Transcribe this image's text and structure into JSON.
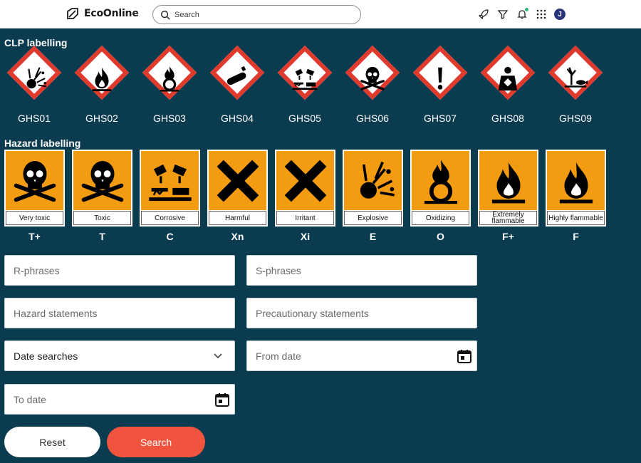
{
  "app": {
    "name": "EcoOnline"
  },
  "search": {
    "placeholder": "Search"
  },
  "header": {
    "user_initial": "J"
  },
  "clp": {
    "title": "CLP labelling",
    "items": [
      {
        "code": "GHS01",
        "icon": "exploding-bomb-icon"
      },
      {
        "code": "GHS02",
        "icon": "flame-icon"
      },
      {
        "code": "GHS03",
        "icon": "flame-over-circle-icon"
      },
      {
        "code": "GHS04",
        "icon": "gas-cylinder-icon"
      },
      {
        "code": "GHS05",
        "icon": "corrosion-icon"
      },
      {
        "code": "GHS06",
        "icon": "skull-crossbones-icon"
      },
      {
        "code": "GHS07",
        "icon": "exclamation-icon"
      },
      {
        "code": "GHS08",
        "icon": "health-hazard-icon"
      },
      {
        "code": "GHS09",
        "icon": "environment-icon"
      }
    ]
  },
  "hazard": {
    "title": "Hazard labelling",
    "items": [
      {
        "label": "Very toxic",
        "code": "T+",
        "icon": "skull-crossbones-icon"
      },
      {
        "label": "Toxic",
        "code": "T",
        "icon": "skull-crossbones-icon"
      },
      {
        "label": "Corrosive",
        "code": "C",
        "icon": "corrosion-icon"
      },
      {
        "label": "Harmful",
        "code": "Xn",
        "icon": "cross-icon"
      },
      {
        "label": "Irritant",
        "code": "Xi",
        "icon": "cross-icon"
      },
      {
        "label": "Explosive",
        "code": "E",
        "icon": "exploding-bomb-icon"
      },
      {
        "label": "Oxidizing",
        "code": "O",
        "icon": "flame-over-circle-icon"
      },
      {
        "label": "Extremely flammable",
        "code": "F+",
        "icon": "flame-icon"
      },
      {
        "label": "Highly flammable",
        "code": "F",
        "icon": "flame-icon"
      }
    ]
  },
  "form": {
    "r_phrases": "R-phrases",
    "s_phrases": "S-phrases",
    "hazard_statements": "Hazard statements",
    "precautionary_statements": "Precautionary statements",
    "date_searches": "Date searches",
    "from_date": "From date",
    "to_date": "To date",
    "reset_label": "Reset",
    "search_label": "Search"
  },
  "colors": {
    "background": "#0b3b4e",
    "accent": "#f0543e",
    "ghs_border": "#e03a2c",
    "legacy_orange": "#f39c12"
  }
}
